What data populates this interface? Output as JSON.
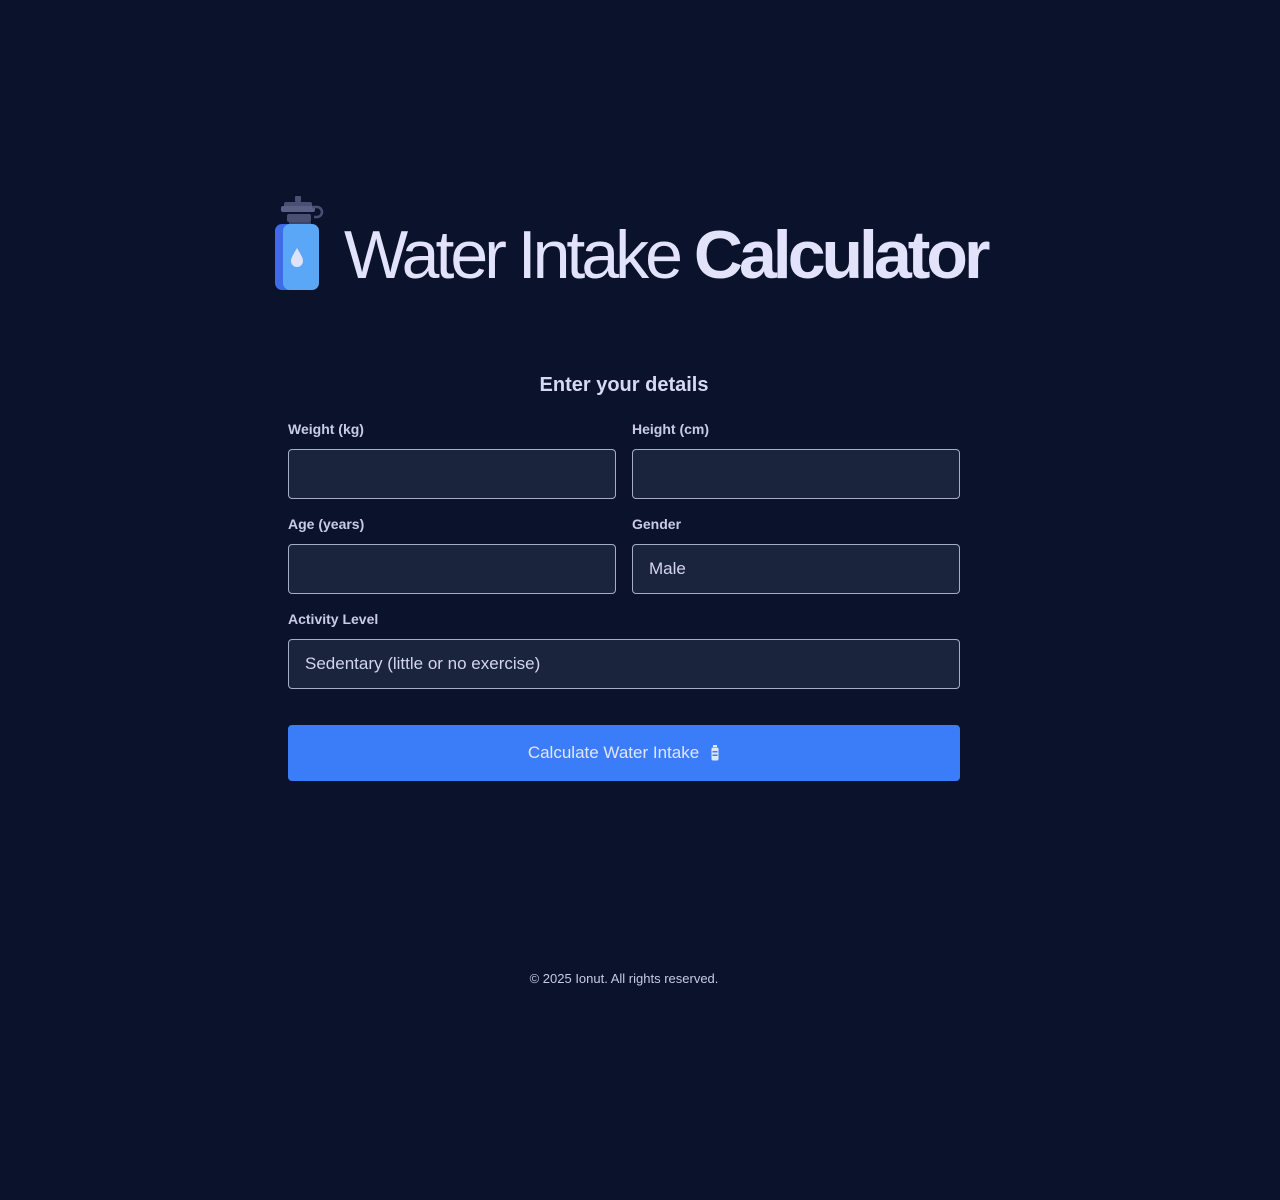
{
  "header": {
    "title_light": "Water Intake",
    "title_bold": "Calculator",
    "icon": "water-bottle-icon"
  },
  "form": {
    "title": "Enter your details",
    "weight": {
      "label": "Weight (kg)",
      "value": ""
    },
    "height": {
      "label": "Height (cm)",
      "value": ""
    },
    "age": {
      "label": "Age (years)",
      "value": ""
    },
    "gender": {
      "label": "Gender",
      "value": "Male"
    },
    "activity": {
      "label": "Activity Level",
      "value": "Sedentary (little or no exercise)"
    },
    "submit_label": "Calculate Water Intake",
    "submit_icon": "water-bottle-icon"
  },
  "footer": {
    "text": "© 2025 Ionut. All rights reserved."
  },
  "colors": {
    "background": "#0a132b",
    "input_bg": "#1a243c",
    "accent": "#3b7df8",
    "text": "#dcdcf5"
  }
}
